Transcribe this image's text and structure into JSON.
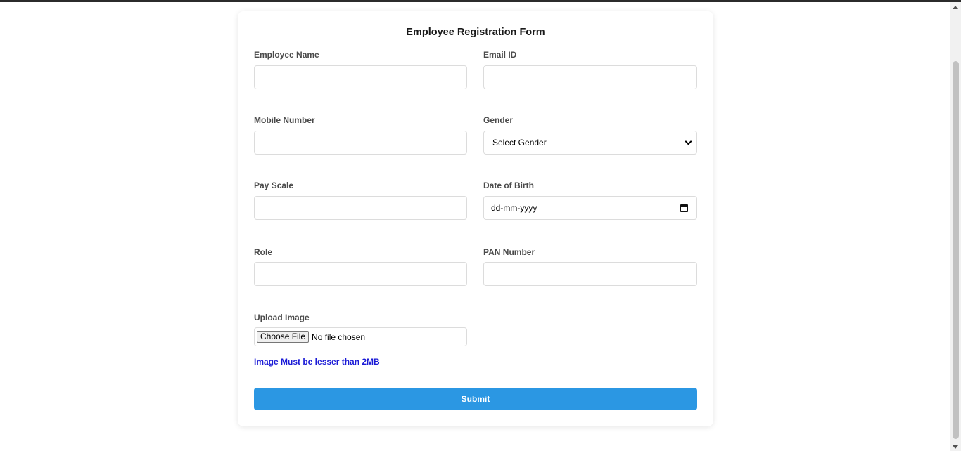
{
  "form": {
    "title": "Employee Registration Form",
    "fields": {
      "employee_name": {
        "label": "Employee Name",
        "value": ""
      },
      "email": {
        "label": "Email ID",
        "value": ""
      },
      "mobile": {
        "label": "Mobile Number",
        "value": ""
      },
      "gender": {
        "label": "Gender",
        "selected": "Select Gender"
      },
      "pay_scale": {
        "label": "Pay Scale",
        "value": ""
      },
      "dob": {
        "label": "Date of Birth",
        "placeholder": "dd-mm-yyyy"
      },
      "role": {
        "label": "Role",
        "value": ""
      },
      "pan": {
        "label": "PAN Number",
        "value": ""
      },
      "upload": {
        "label": "Upload Image",
        "button_label": "Choose File",
        "status": "No file chosen",
        "hint": "Image Must be lesser than 2MB"
      }
    },
    "submit_label": "Submit"
  },
  "colors": {
    "submit_bg": "#2b97e3",
    "hint_text": "#1a1ad6"
  }
}
